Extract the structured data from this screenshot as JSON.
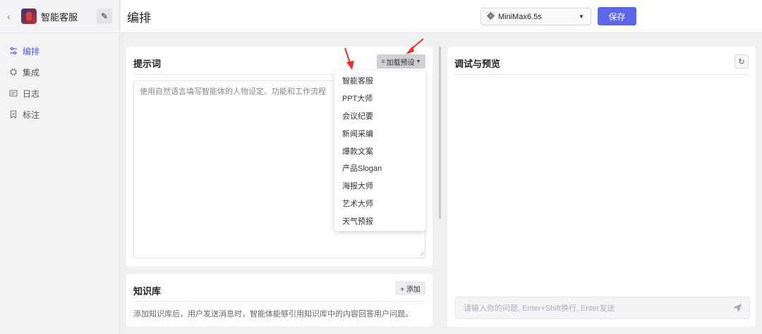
{
  "sidebar": {
    "back_icon": "chevron-left-icon",
    "app_name": "智能客服",
    "edit_icon": "pencil-icon",
    "items": [
      {
        "label": "编排",
        "icon": "sliders-icon",
        "active": true
      },
      {
        "label": "集成",
        "icon": "chip-icon",
        "active": false
      },
      {
        "label": "日志",
        "icon": "list-icon",
        "active": false
      },
      {
        "label": "标注",
        "icon": "bookmark-icon",
        "active": false
      }
    ]
  },
  "header": {
    "title": "编排",
    "model": "MiniMax6.5s",
    "save_label": "保存"
  },
  "prompt": {
    "title": "提示词",
    "preset_label": "加载预设",
    "placeholder": "使用自然语言填写智能体的人物设定、功能和工作流程",
    "presets": [
      "智能客服",
      "PPT大师",
      "会议纪要",
      "新闻采编",
      "爆款文案",
      "产品Slogan",
      "海报大师",
      "艺术大师",
      "天气预报"
    ]
  },
  "knowledge": {
    "title": "知识库",
    "add_label": "+ 添加",
    "description": "添加知识库后，用户发送消息时，智能体能够引用知识库中的内容回答用户问题。"
  },
  "debug": {
    "title": "调试与预览",
    "input_placeholder": "请输入你的问题, Enter+Shift换行, Enter发送"
  },
  "colors": {
    "accent": "#5b67ea",
    "arrow": "#e8322b"
  }
}
